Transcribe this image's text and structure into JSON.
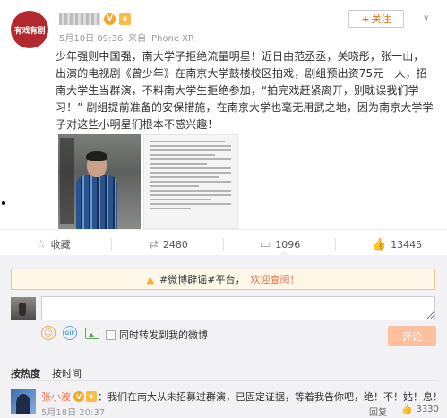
{
  "post": {
    "avatar_text": "有戏有剧",
    "time": "5月10日 09:36",
    "source": "来自 iPhone XR",
    "follow_label": "关注",
    "text": "少年强则中国强，南大学子拒绝流量明星！近日由范丞丞，关晓彤，张一山，出演的电视剧《曾少年》在南京大学鼓楼校区拍戏，剧组预出资75元一人，招南大学生当群演，不料南大学生拒绝参加，“拍完戏赶紧离开，别耽误我们学习！” 剧组提前准备的安保措施，在南京大学也毫无用武之地，因为南京大学学子对这些小明星们根本不感兴趣！"
  },
  "actions": {
    "collect": "收藏",
    "repost": "2480",
    "comment": "1096",
    "like": "13445"
  },
  "comment_box": {
    "notice_prefix": "#微博辟谣#平台，",
    "notice_link": "欢迎查阅！",
    "input_value": "",
    "repost_check_label": "同时转发到我的微博",
    "submit_label": "评论"
  },
  "sort": {
    "hot": "按热度",
    "time": "按时间"
  },
  "comment": {
    "name": "张小波",
    "text": "：我们在南大从未招募过群演，已固定证据，等着我告你吧，绝！不！姑！息！",
    "time": "5月18日 20:37",
    "reply": "回复",
    "likes": "3330"
  },
  "icons": [
    "v-verified-icon",
    "level-badge-icon",
    "chevron-down-icon",
    "star-icon",
    "repost-icon",
    "comment-icon",
    "thumbs-up-icon",
    "warning-icon",
    "emoji-icon",
    "gif-icon",
    "image-icon"
  ],
  "colors": {
    "accent": "#eb7350",
    "follow": "#ff6600",
    "submit": "#ffc09f",
    "comment_bg": "#f2f2f5"
  }
}
